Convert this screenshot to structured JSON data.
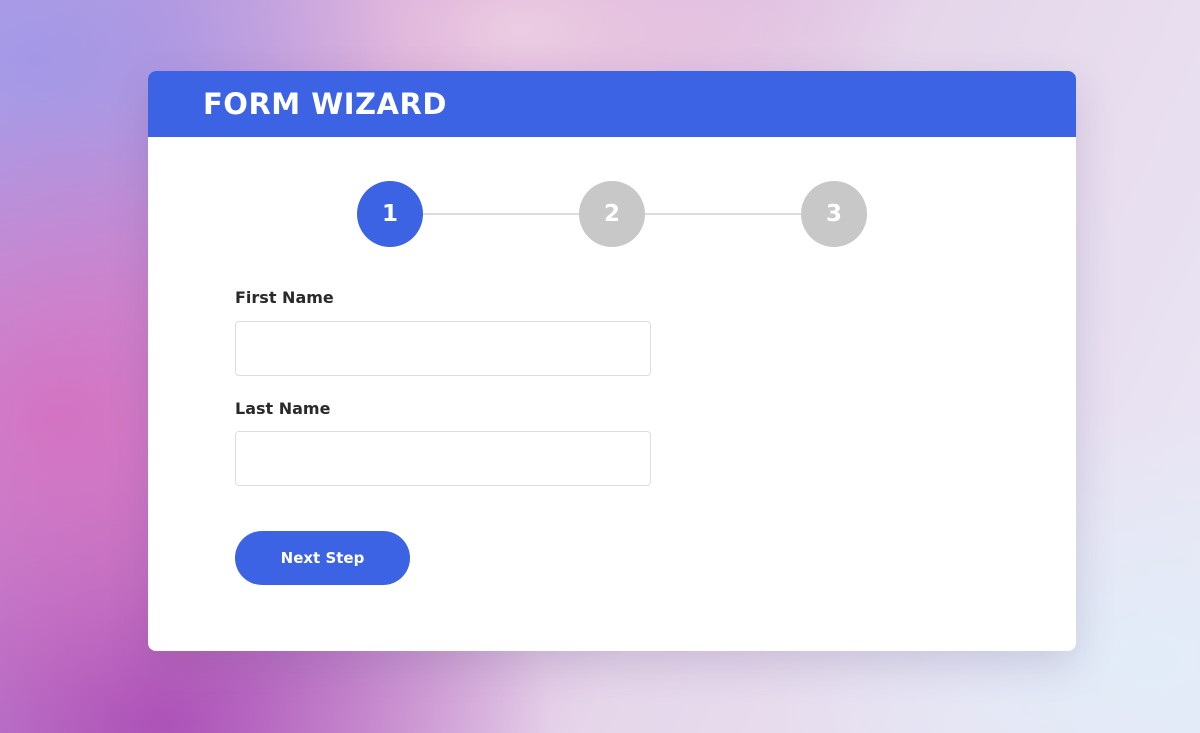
{
  "wizard": {
    "title": "FORM WIZARD",
    "steps": [
      {
        "label": "1",
        "state": "active"
      },
      {
        "label": "2",
        "state": "inactive"
      },
      {
        "label": "3",
        "state": "inactive"
      }
    ],
    "fields": [
      {
        "label": "First Name",
        "value": "",
        "placeholder": ""
      },
      {
        "label": "Last Name",
        "value": "",
        "placeholder": ""
      }
    ],
    "next_button_label": "Next Step"
  },
  "colors": {
    "accent": "#3b63e3",
    "step_inactive": "#c8c8c8",
    "label_text": "#2a2a2a"
  }
}
